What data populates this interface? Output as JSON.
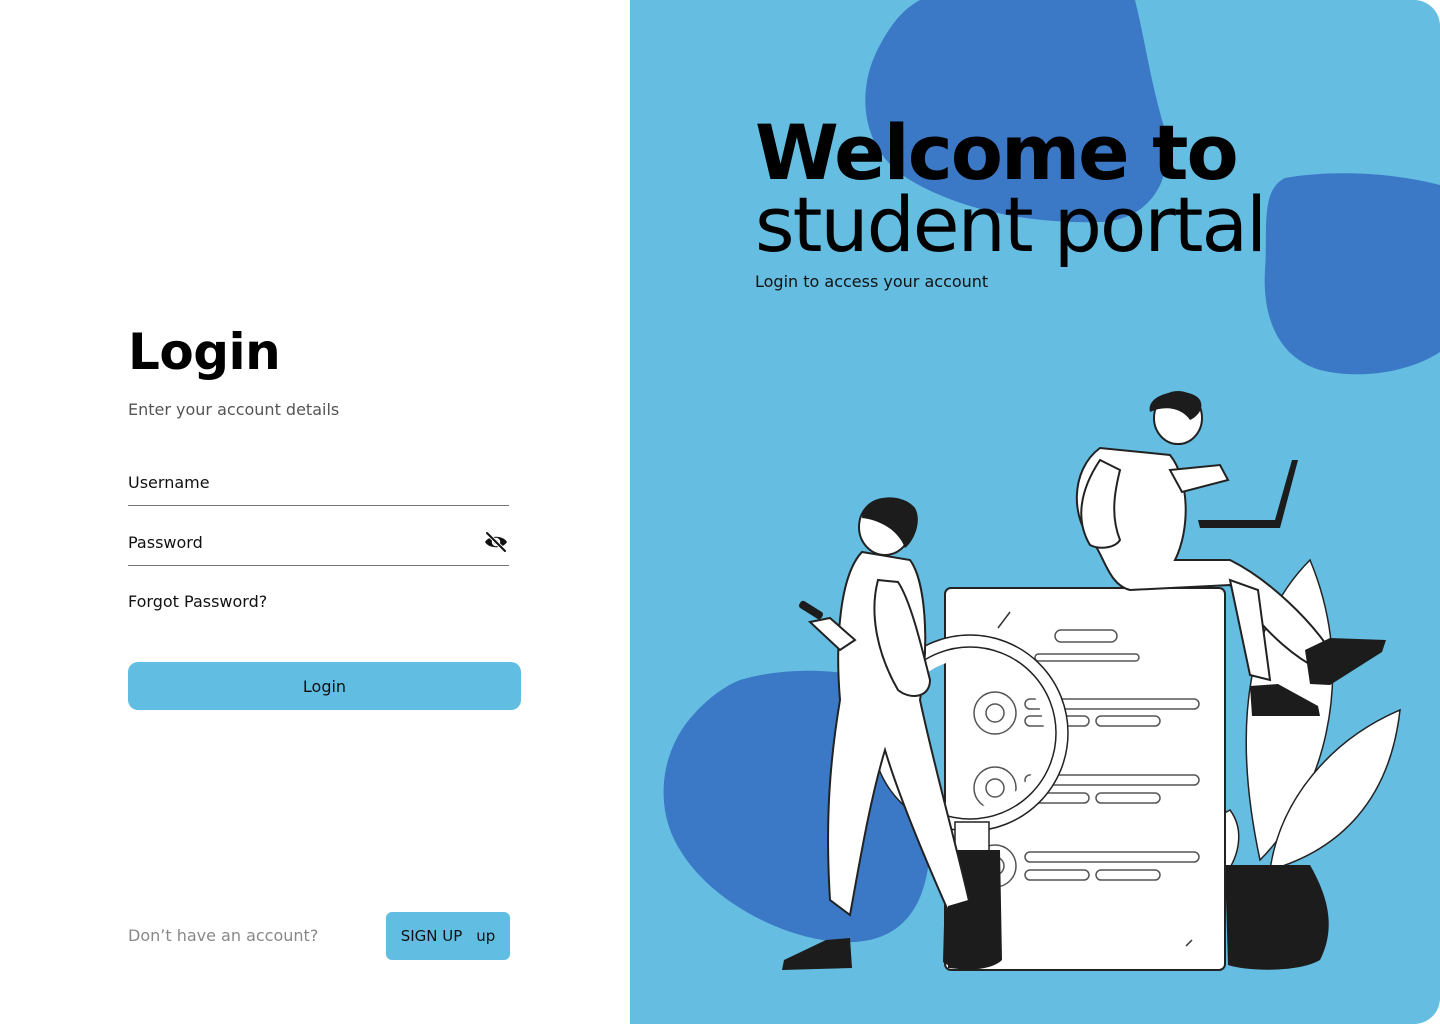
{
  "login": {
    "title": "Login",
    "subtitle": "Enter your account details",
    "username_label": "Username",
    "password_label": "Password",
    "forgot_password": "Forgot Password?",
    "login_button": "Login"
  },
  "signup": {
    "prompt": "Don’t have an account?",
    "button_label": "SIGN UP",
    "button_suffix": "up"
  },
  "welcome": {
    "line1": "Welcome to",
    "line2": "student portal",
    "subtitle": "Login to access your account"
  },
  "icons": {
    "password_toggle": "eye-slash-icon"
  },
  "colors": {
    "accent": "#62BDE2",
    "panel_bg": "#65BDE1",
    "blob": "#3B79C6",
    "text": "#000000",
    "muted_text": "#888888"
  }
}
